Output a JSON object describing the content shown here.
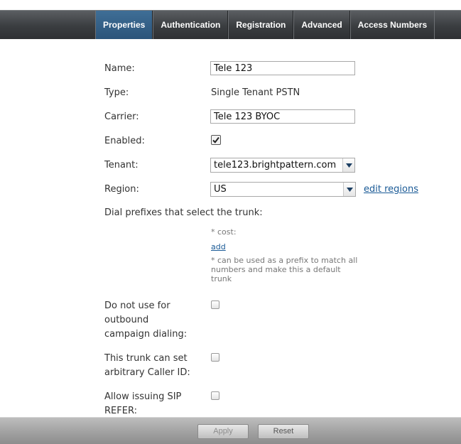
{
  "tabs": [
    {
      "label": "Properties",
      "active": true
    },
    {
      "label": "Authentication",
      "active": false
    },
    {
      "label": "Registration",
      "active": false
    },
    {
      "label": "Advanced",
      "active": false
    },
    {
      "label": "Access Numbers",
      "active": false
    }
  ],
  "form": {
    "name_label": "Name:",
    "name_value": "Tele 123",
    "type_label": "Type:",
    "type_value": "Single Tenant PSTN",
    "carrier_label": "Carrier:",
    "carrier_value": "Tele 123 BYOC",
    "enabled_label": "Enabled:",
    "enabled_checked": true,
    "tenant_label": "Tenant:",
    "tenant_value": "tele123.brightpattern.com",
    "region_label": "Region:",
    "region_value": "US",
    "edit_regions_link": "edit regions",
    "dial_prefixes_label": "Dial prefixes that select the trunk:",
    "cost_label": "* cost:",
    "add_link": "add",
    "prefix_hint": [
      "* can be used as a prefix to match all",
      "numbers and make this a default",
      "trunk"
    ],
    "no_outbound_label": [
      "Do not use for",
      "outbound",
      "campaign dialing:"
    ],
    "no_outbound_checked": false,
    "caller_id_label": [
      "This trunk can set",
      "arbitrary Caller ID:"
    ],
    "caller_id_checked": false,
    "sip_refer_label": [
      "Allow issuing SIP",
      "REFER:"
    ],
    "sip_refer_checked": false
  },
  "footer": {
    "apply_label": "Apply",
    "reset_label": "Reset"
  },
  "colors": {
    "active_tab": "#2b547a",
    "link": "#1a5a96"
  }
}
